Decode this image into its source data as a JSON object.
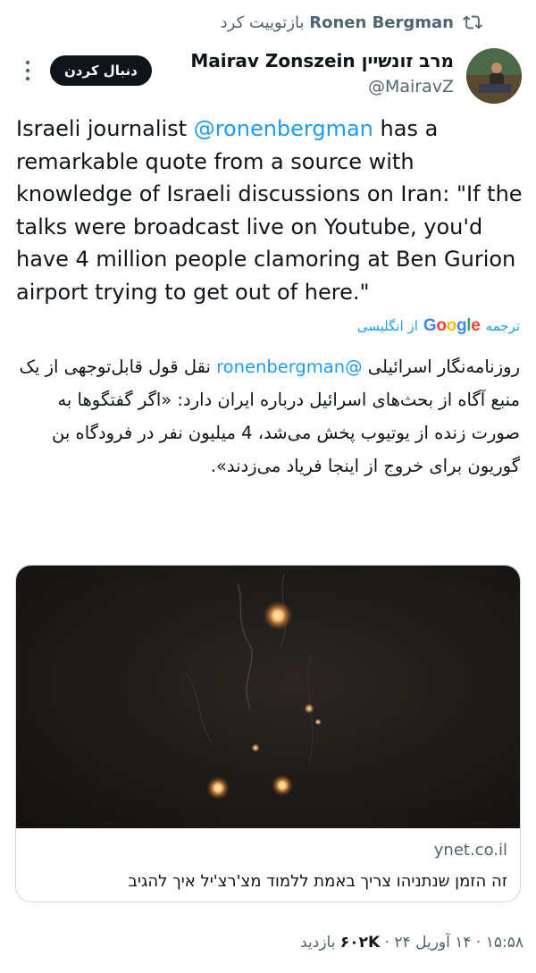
{
  "retweet": {
    "user": "Ronen Bergman",
    "action": "بازتوییت کرد",
    "icon": "retweet-icon"
  },
  "author": {
    "display_name": "Mairav Zonszein מרב זונשיין",
    "handle": "@MairavZ",
    "avatar": "avatar"
  },
  "follow_button": "دنبال کردن",
  "tweet": {
    "part1": "Israeli journalist ",
    "mention": "@ronenbergman",
    "part2": " has a remarkable quote from a source with knowledge of Israeli discussions on Iran: \"If the talks were broadcast live on Youtube, you'd have 4 million people clamoring at Ben Gurion airport trying to get out of here.\""
  },
  "translate": {
    "prefix": "ترجمه",
    "google": "Google",
    "suffix": "از انگلیسی"
  },
  "translation": {
    "part1": "روزنامه‌نگار اسرائیلی ",
    "mention": "@ronenbergman",
    "part2": " نقل قول قابل‌توجهی از یک منبع آگاه از بحث‌های اسرائیل درباره ایران دارد: «اگر گفتگوها به صورت زنده از یوتیوب پخش می‌شد، 4 میلیون نفر در فرودگاه بن گوریون برای خروج از اینجا فریاد می‌زدند»."
  },
  "card": {
    "domain": "ynet.co.il",
    "title": "זה הזמן שנתניהו צריך באמת ללמוד מצ'רצ'יל איך להגיב"
  },
  "meta": {
    "time": "۱۵:۵۸",
    "date": "۱۴ آوریل ۲۴",
    "views": "۶۰۲K",
    "views_label": "بازدید",
    "separator": " · "
  },
  "colors": {
    "accent": "#1d9bf0",
    "text": "#0f1419",
    "secondary": "#536471",
    "button_bg": "#0f1419"
  }
}
